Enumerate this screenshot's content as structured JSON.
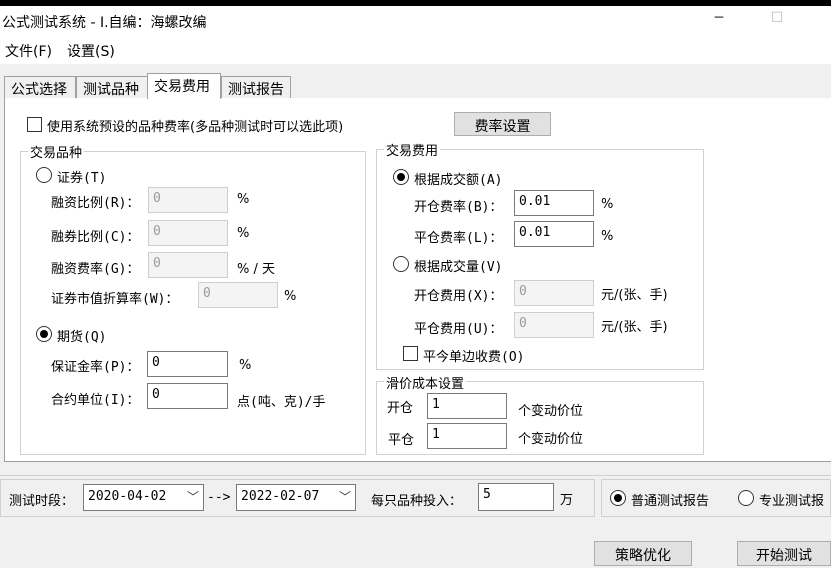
{
  "window": {
    "title": "公式测试系统 - I.自编：海螺改编",
    "min_glyph": "─",
    "max_glyph": "☐"
  },
  "menu": [
    {
      "label": "文件(F)"
    },
    {
      "label": "设置(S)"
    }
  ],
  "tabs": [
    {
      "label": "公式选择"
    },
    {
      "label": "测试品种"
    },
    {
      "label": "交易费用"
    },
    {
      "label": "测试报告"
    }
  ],
  "active_tab": 2,
  "preset_rate": {
    "label": "使用系统预设的品种费率(多品种测试时可以选此项)",
    "checked": false,
    "button": "费率设置"
  },
  "instrument": {
    "title": "交易品种",
    "securities": {
      "label": "证券(T)",
      "selected": false,
      "margin_finance_label": "融资比例(R)：",
      "margin_finance_value": "0",
      "margin_finance_unit": "%",
      "short_sell_label": "融券比例(C)：",
      "short_sell_value": "0",
      "short_sell_unit": "%",
      "finance_rate_label": "融资费率(G)：",
      "finance_rate_value": "0",
      "finance_rate_unit": "% / 天",
      "discount_label": "证券市值折算率(W)：",
      "discount_value": "0",
      "discount_unit": "%"
    },
    "futures": {
      "label": "期货(Q)",
      "selected": true,
      "margin_label": "保证金率(P)：",
      "margin_value": "0",
      "margin_unit": "%",
      "contract_label": "合约单位(I)：",
      "contract_value": "0",
      "contract_unit": "点(吨、克)/手"
    }
  },
  "fees": {
    "title": "交易费用",
    "by_amount": {
      "label": "根据成交额(A)",
      "selected": true,
      "open_label": "开仓费率(B)：",
      "open_value": "0.01",
      "open_unit": "%",
      "close_label": "平仓费率(L)：",
      "close_value": "0.01",
      "close_unit": "%"
    },
    "by_volume": {
      "label": "根据成交量(V)",
      "selected": false,
      "open_label": "开仓费用(X)：",
      "open_value": "0",
      "open_unit": "元/(张、手)",
      "close_label": "平仓费用(U)：",
      "close_value": "0",
      "close_unit": "元/(张、手)"
    },
    "same_day": {
      "label": "平今单边收费(O)",
      "checked": false
    }
  },
  "slippage": {
    "title": "滑价成本设置",
    "open_label": "开仓",
    "open_value": "1",
    "open_unit": "个变动价位",
    "close_label": "平仓",
    "close_value": "1",
    "close_unit": "个变动价位"
  },
  "bottom": {
    "period_label": "测试时段：",
    "start_date": "2020-04-02",
    "arrow": "-->",
    "end_date": "2022-02-07",
    "invest_label": "每只品种投入：",
    "invest_value": "5",
    "invest_unit": "万",
    "report_normal": "普通测试报告",
    "report_normal_selected": true,
    "report_pro": "专业测试报",
    "report_pro_selected": false,
    "optimize_button": "策略优化",
    "start_button": "开始测试"
  }
}
